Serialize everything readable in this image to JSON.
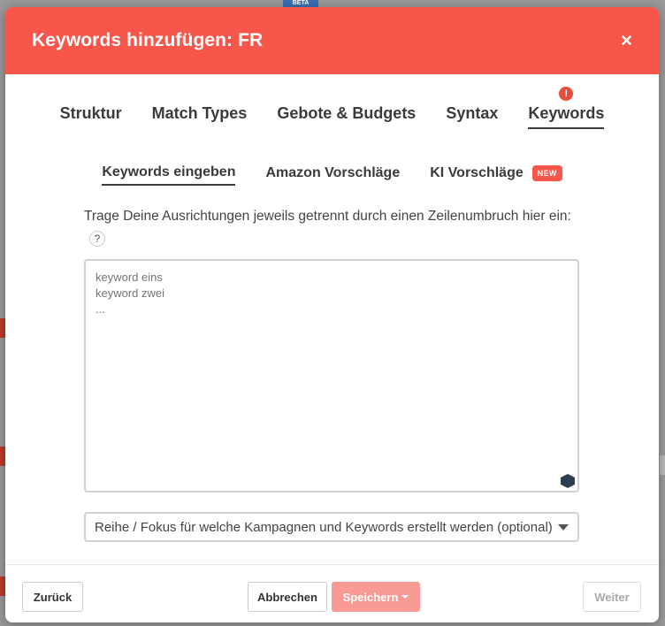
{
  "background": {
    "beta_label": "BETA"
  },
  "modal": {
    "title": "Keywords hinzufügen: FR",
    "close_symbol": "×"
  },
  "main_tabs": [
    {
      "label": "Struktur"
    },
    {
      "label": "Match Types"
    },
    {
      "label": "Gebote & Budgets"
    },
    {
      "label": "Syntax"
    },
    {
      "label": "Keywords",
      "active": true,
      "alert": "!"
    }
  ],
  "sub_tabs": [
    {
      "label": "Keywords eingeben",
      "active": true
    },
    {
      "label": "Amazon Vorschläge"
    },
    {
      "label": "KI Vorschläge",
      "badge": "NEW"
    }
  ],
  "instructions": {
    "text": "Trage Deine Ausrichtungen jeweils getrennt durch einen Zeilenumbruch hier ein:",
    "help_symbol": "?"
  },
  "keywords_input": {
    "placeholder": "keyword eins\nkeyword zwei\n..."
  },
  "focus_select": {
    "value": "Reihe / Fokus für welche Kampagnen und Keywords erstellt werden (optional)"
  },
  "footer": {
    "back_label": "Zurück",
    "cancel_label": "Abbrechen",
    "save_label": "Speichern",
    "next_label": "Weiter"
  },
  "colors": {
    "header": "#f7564a",
    "save_button": "#f99b94",
    "alert": "#e74c3c"
  }
}
